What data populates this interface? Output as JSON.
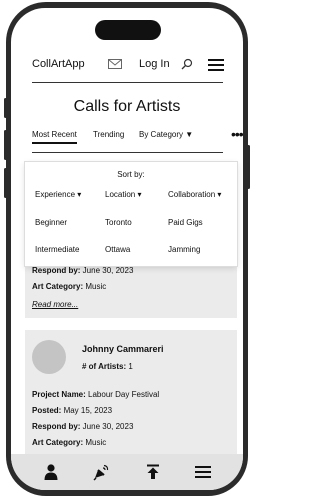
{
  "header": {
    "logo": "CollArtApp",
    "login_label": "Log In"
  },
  "page_title": "Calls for Artists",
  "tabs": [
    {
      "label": "Most Recent",
      "active": true
    },
    {
      "label": "Trending",
      "active": false
    },
    {
      "label": "By Category ▼",
      "active": false
    },
    {
      "label": "•••",
      "active": false
    }
  ],
  "sort_panel": {
    "label": "Sort by:",
    "columns": [
      {
        "header": "Experience ▾",
        "options": [
          "Beginner",
          "Intermediate"
        ]
      },
      {
        "header": "Location ▾",
        "options": [
          "Toronto",
          "Ottawa"
        ]
      },
      {
        "header": "Collaboration ▾",
        "options": [
          "Paid Gigs",
          "Jamming"
        ]
      }
    ]
  },
  "cards": [
    {
      "respond_by_label": "Respond by:",
      "respond_by_value": " June 30, 2023",
      "category_label": "Art Category:",
      "category_value": " Music",
      "read_more": "Read more..."
    },
    {
      "name": "Johnny Cammareri",
      "artists_label": "# of Artists:",
      "artists_value": " 1",
      "project_label": "Project Name:",
      "project_value": " Labour Day Festival",
      "posted_label": "Posted:",
      "posted_value": " May 15, 2023",
      "respond_by_label": "Respond by:",
      "respond_by_value": " June 30, 2023",
      "category_label": "Art Category:",
      "category_value": " Music"
    }
  ],
  "icons": {
    "mail": "mail-icon",
    "search": "search-icon",
    "menu": "hamburger-menu-icon",
    "nav": [
      "user-icon",
      "announcement-icon",
      "upload-icon",
      "hamburger-menu-icon"
    ]
  }
}
